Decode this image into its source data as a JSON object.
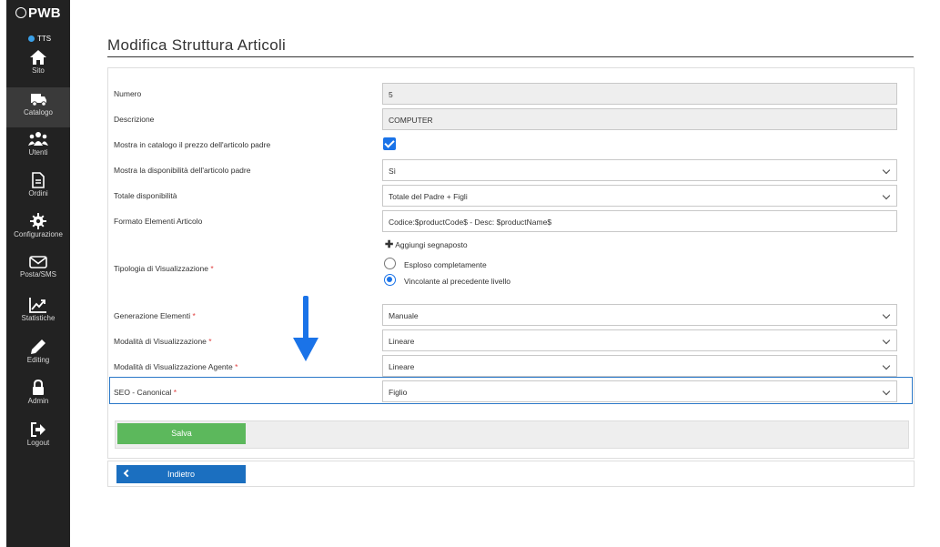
{
  "sidebar": {
    "logo": "PWB",
    "status": "TTS",
    "items": [
      {
        "label": "Sito",
        "icon": "home-icon"
      },
      {
        "label": "Catalogo",
        "icon": "truck-icon"
      },
      {
        "label": "Utenti",
        "icon": "users-icon"
      },
      {
        "label": "Ordini",
        "icon": "document-icon"
      },
      {
        "label": "Configurazione",
        "icon": "gear-icon"
      },
      {
        "label": "Posta/SMS",
        "icon": "envelope-icon"
      },
      {
        "label": "Statistiche",
        "icon": "chart-icon"
      },
      {
        "label": "Editing",
        "icon": "pencil-icon"
      },
      {
        "label": "Admin",
        "icon": "lock-icon"
      },
      {
        "label": "Logout",
        "icon": "logout-icon"
      }
    ],
    "active": "Catalogo"
  },
  "page": {
    "title": "Modifica Struttura Articoli"
  },
  "form": {
    "numero": {
      "label": "Numero",
      "value": "5"
    },
    "descrizione": {
      "label": "Descrizione",
      "value": "COMPUTER"
    },
    "prezzo_padre": {
      "label": "Mostra in catalogo il prezzo dell'articolo padre",
      "checked": true
    },
    "disponibilita_padre": {
      "label": "Mostra la disponibilità dell'articolo padre",
      "value": "Sì"
    },
    "totale_disponibilita": {
      "label": "Totale disponibilità",
      "value": "Totale del Padre + Figli"
    },
    "formato": {
      "label": "Formato Elementi Articolo",
      "value": "Codice:$productCode$ - Desc: $productName$"
    },
    "aggiungi": "Aggiungi segnaposto",
    "tipologia": {
      "label": "Tipologia di Visualizzazione",
      "required": "*",
      "options": [
        "Esploso completamente",
        "Vincolante al precedente livello"
      ],
      "selected": "Vincolante al precedente livello"
    },
    "generazione": {
      "label": "Generazione Elementi",
      "required": "*",
      "value": "Manuale"
    },
    "modalita": {
      "label": "Modalità di Visualizzazione",
      "required": "*",
      "value": "Lineare"
    },
    "modalita_agente": {
      "label": "Modalità di Visualizzazione Agente",
      "required": "*",
      "value": "Lineare"
    },
    "seo": {
      "label": "SEO - Canonical",
      "required": "*",
      "value": "Figlio"
    }
  },
  "buttons": {
    "save": "Salva",
    "back": "Indietro"
  },
  "colors": {
    "sidebar": "#222222",
    "accent": "#1a73e8",
    "save": "#5cb85c",
    "back": "#1b6fc0",
    "highlight": "#2a78c8"
  }
}
